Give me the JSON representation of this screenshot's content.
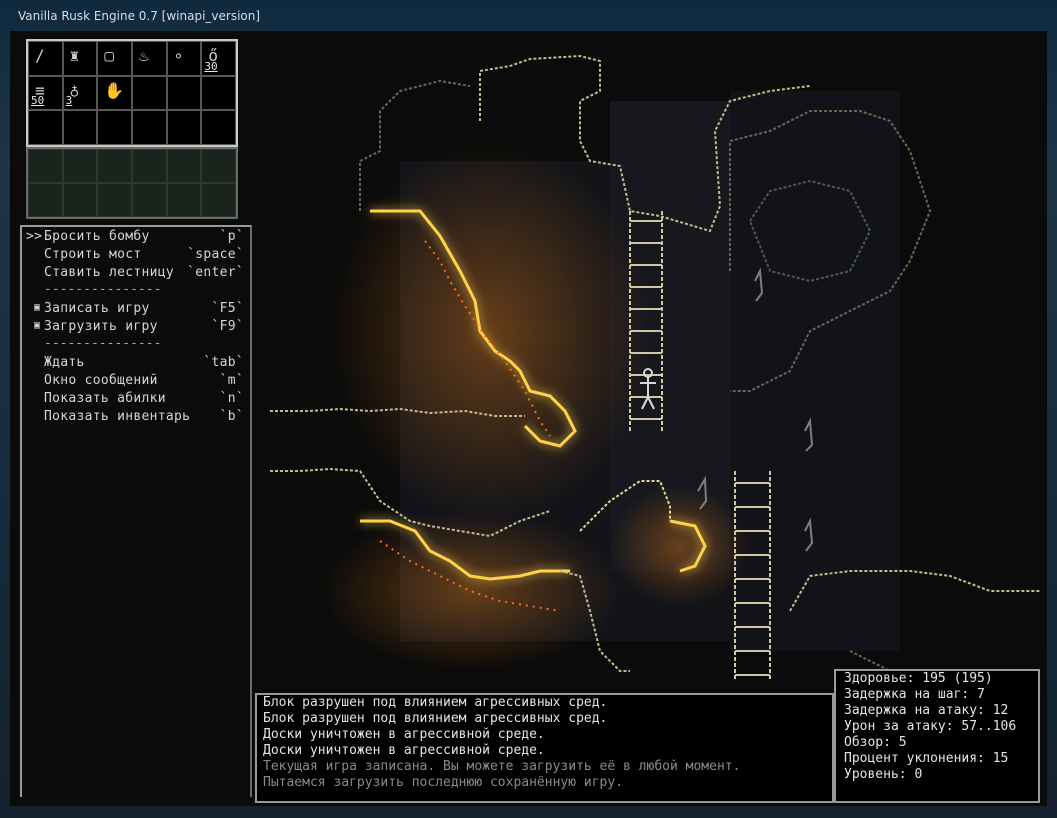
{
  "window": {
    "title": "Vanilla Rusk Engine 0.7 [winapi_version]"
  },
  "inventory": {
    "slots": [
      {
        "icon": "sword-icon",
        "glyph": "/",
        "count": ""
      },
      {
        "icon": "armor-icon",
        "glyph": "♜",
        "count": ""
      },
      {
        "icon": "square-icon",
        "glyph": "▢",
        "count": ""
      },
      {
        "icon": "flask-icon",
        "glyph": "♨",
        "count": ""
      },
      {
        "icon": "orb-icon",
        "glyph": "∘",
        "count": ""
      },
      {
        "icon": "bomb-icon",
        "glyph": "ő",
        "count": "30"
      },
      {
        "icon": "plank-icon",
        "glyph": "≡",
        "count": "50"
      },
      {
        "icon": "rock-icon",
        "glyph": "♁",
        "count": "3"
      },
      {
        "icon": "hand-icon",
        "glyph": "✋",
        "count": ""
      },
      {
        "icon": "",
        "glyph": "",
        "count": ""
      },
      {
        "icon": "",
        "glyph": "",
        "count": ""
      },
      {
        "icon": "",
        "glyph": "",
        "count": ""
      },
      {
        "icon": "",
        "glyph": "",
        "count": ""
      },
      {
        "icon": "",
        "glyph": "",
        "count": ""
      },
      {
        "icon": "",
        "glyph": "",
        "count": ""
      },
      {
        "icon": "",
        "glyph": "",
        "count": ""
      },
      {
        "icon": "",
        "glyph": "",
        "count": ""
      },
      {
        "icon": "",
        "glyph": "",
        "count": ""
      }
    ]
  },
  "menu": {
    "selector": ">>",
    "items": [
      {
        "label": "Бросить бомбу",
        "key": "`p`"
      },
      {
        "label": "Строить мост",
        "key": "`space`"
      },
      {
        "label": "Ставить лестницу",
        "key": "`enter`"
      },
      {
        "separator": "---------------"
      },
      {
        "label": "Записать игру",
        "key": "`F5`"
      },
      {
        "label": "Загрузить игру",
        "key": "`F9`"
      },
      {
        "separator": "---------------"
      },
      {
        "label": "Ждать",
        "key": "`tab`"
      },
      {
        "label": "Окно сообщений",
        "key": "`m`"
      },
      {
        "label": "Показать абилки",
        "key": "`n`"
      },
      {
        "label": "Показать инвентарь",
        "key": "`b`"
      }
    ]
  },
  "log": {
    "lines": [
      {
        "text": "Блок разрушен под влиянием агрессивных сред.",
        "dim": false
      },
      {
        "text": "Блок разрушен под влиянием агрессивных сред.",
        "dim": false
      },
      {
        "text": "Доски уничтожен в агрессивной среде.",
        "dim": false
      },
      {
        "text": "Доски уничтожен в агрессивной среде.",
        "dim": false
      },
      {
        "text": "Текущая игра записана. Вы можете загрузить её в любой момент.",
        "dim": true
      },
      {
        "text": "Пытаемся загрузить последнюю сохранённую игру.",
        "dim": true
      }
    ]
  },
  "stats": {
    "lines": [
      "Здоровье: 195 (195)",
      "Задержка на шаг: 7",
      "Задержка на атаку: 12",
      "Урон за атаку: 57..106",
      "Обзор: 5",
      "Процент уклонения: 15",
      "Уровень: 0"
    ]
  },
  "colors": {
    "lava": "#ff8a1a",
    "lava_glow": "#ffd24a",
    "stone": "#c9b98a",
    "stone_dim": "#6d6550",
    "ladder": "#d2c6a4"
  }
}
